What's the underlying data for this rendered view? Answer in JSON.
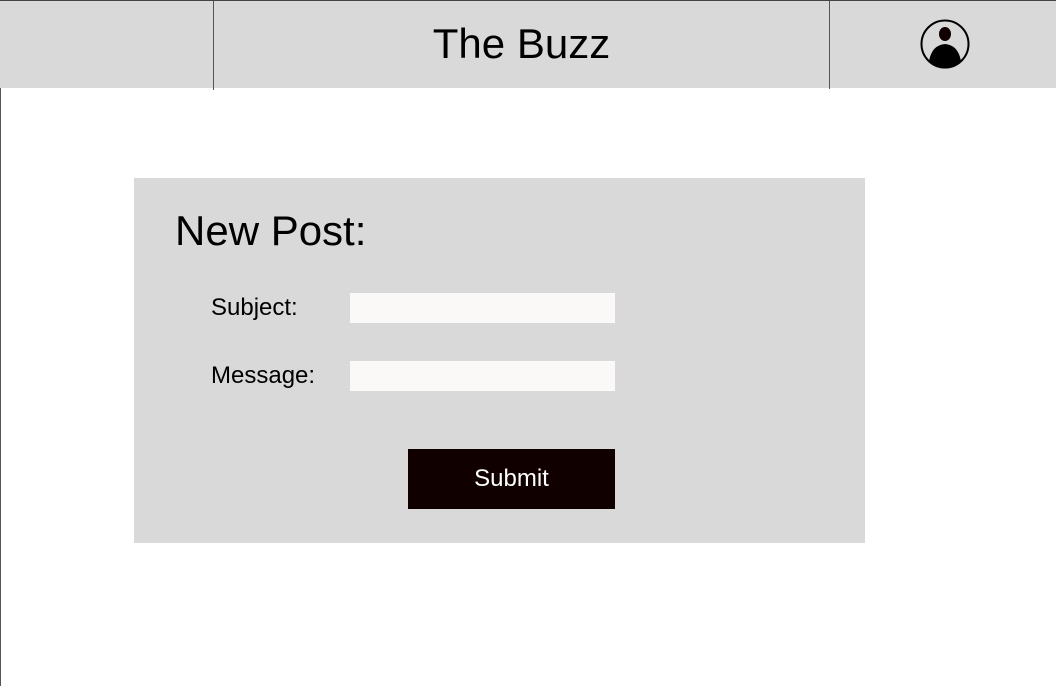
{
  "header": {
    "title": "The Buzz",
    "profile_icon": "user-circle-icon"
  },
  "form": {
    "title": "New Post:",
    "subject_label": "Subject:",
    "subject_value": "",
    "message_label": "Message:",
    "message_value": "",
    "submit_label": "Submit"
  },
  "colors": {
    "header_bg": "#d9d9d9",
    "panel_bg": "#d9d9d9",
    "button_bg": "#100000",
    "input_bg": "#faf9f8"
  }
}
